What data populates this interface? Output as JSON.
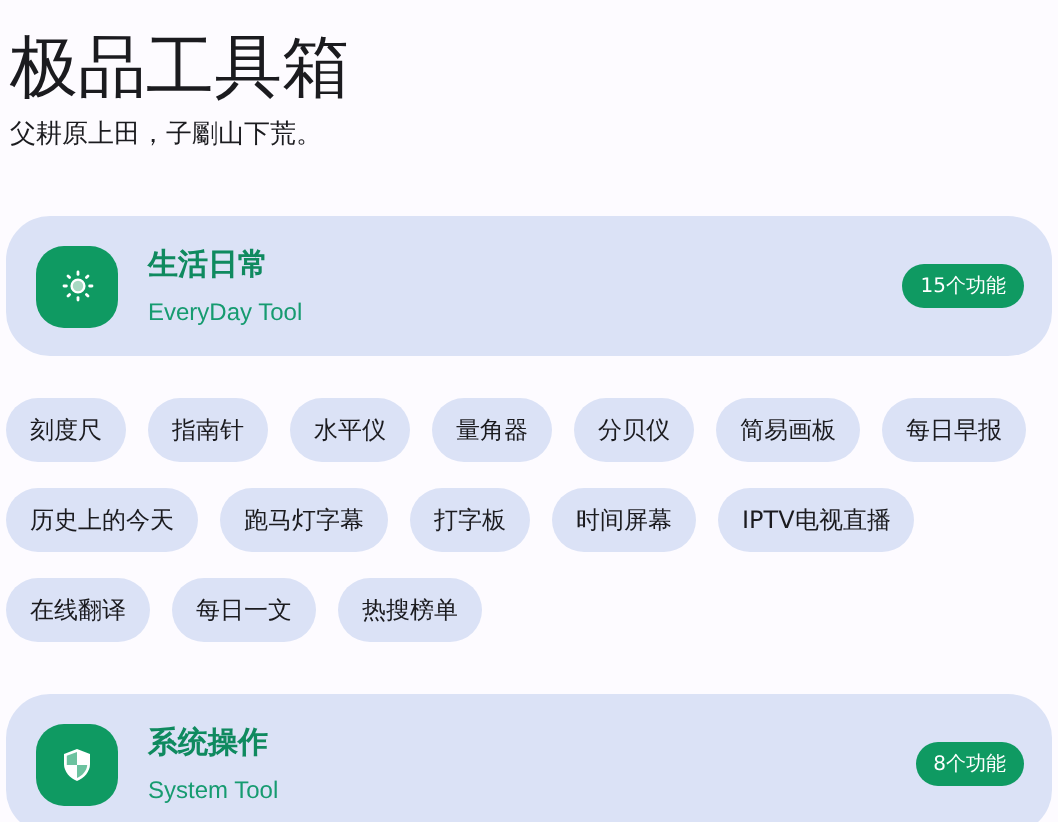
{
  "app": {
    "title": "极品工具箱",
    "subtitle": "父耕原上田，子劚山下荒。"
  },
  "sections": [
    {
      "title": "生活日常",
      "subtitle": "EveryDay Tool",
      "badge": "15个功能",
      "tools": [
        "刻度尺",
        "指南针",
        "水平仪",
        "量角器",
        "分贝仪",
        "简易画板",
        "每日早报",
        "历史上的今天",
        "跑马灯字幕",
        "打字板",
        "时间屏幕",
        "IPTV电视直播",
        "在线翻译",
        "每日一文",
        "热搜榜单"
      ]
    },
    {
      "title": "系统操作",
      "subtitle": "System Tool",
      "badge": "8个功能"
    }
  ]
}
